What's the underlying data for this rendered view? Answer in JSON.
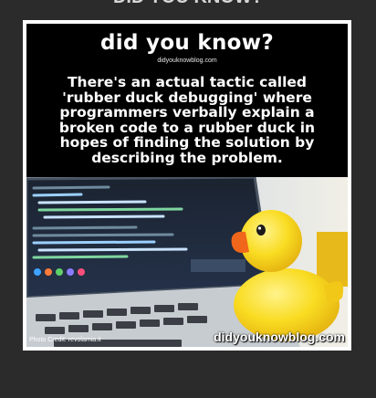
{
  "header_cut": "DID YOU KNOW?",
  "card": {
    "title": "did you know?",
    "site_small": "didyouknowblog.com",
    "fact": "There's an actual tactic called 'rubber duck debugging' where programmers verbally explain a broken code to a rubber duck in hopes of finding the solution by describing the problem.",
    "photo_credit": "Photo Credit: revolamia.it",
    "watermark": "didyouknowblog.com"
  },
  "colors": {
    "background": "#2b2b2b",
    "card_border": "#ffffff",
    "duck_yellow": "#f7d21c",
    "duck_beak": "#f0671c"
  }
}
